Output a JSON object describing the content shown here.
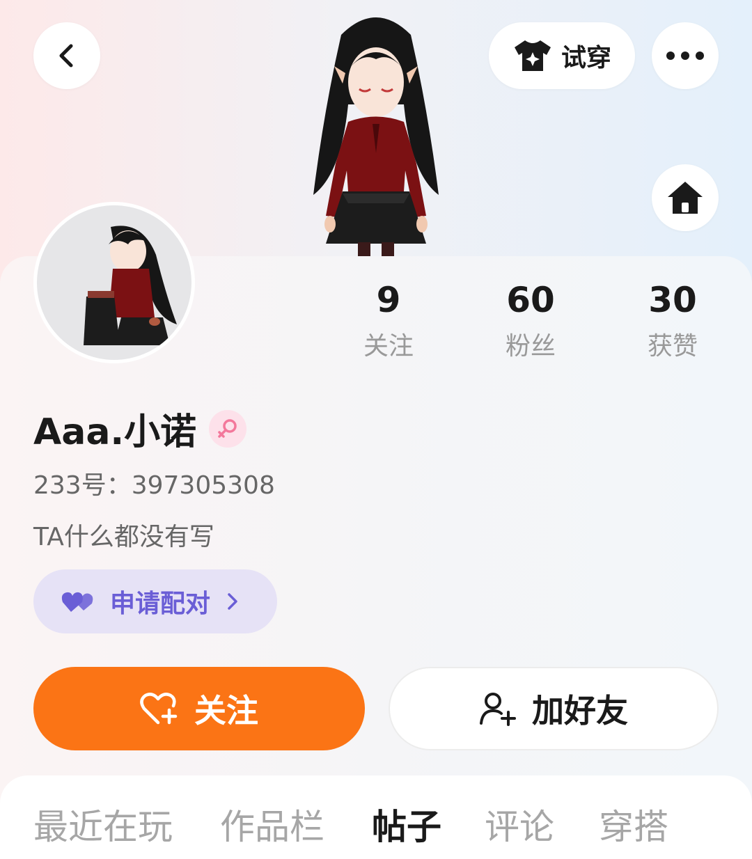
{
  "header": {
    "back_icon": "chevron-left-icon",
    "try_on_label": "试穿",
    "try_on_icon": "shirt-icon",
    "more_icon": "more-dots-icon",
    "home_icon": "home-icon"
  },
  "profile": {
    "name": "Aaa.小诺",
    "gender_icon": "female-icon",
    "user_id": "233号：397305308",
    "bio": "TA什么都没有写"
  },
  "stats": [
    {
      "value": "9",
      "label": "关注"
    },
    {
      "value": "60",
      "label": "粉丝"
    },
    {
      "value": "30",
      "label": "获赞"
    }
  ],
  "pair_button": {
    "label": "申请配对",
    "icon": "hearts-icon"
  },
  "actions": {
    "follow_label": "关注",
    "add_friend_label": "加好友"
  },
  "tabs": [
    {
      "label": "最近在玩",
      "active": false
    },
    {
      "label": "作品栏",
      "active": false
    },
    {
      "label": "帖子",
      "active": true
    },
    {
      "label": "评论",
      "active": false
    },
    {
      "label": "穿搭",
      "active": false
    }
  ],
  "colors": {
    "accent_orange": "#fb7415",
    "pair_purple": "#6a5ed6",
    "pair_bg": "#e6e2f6",
    "gender_pink": "#f3789b"
  }
}
